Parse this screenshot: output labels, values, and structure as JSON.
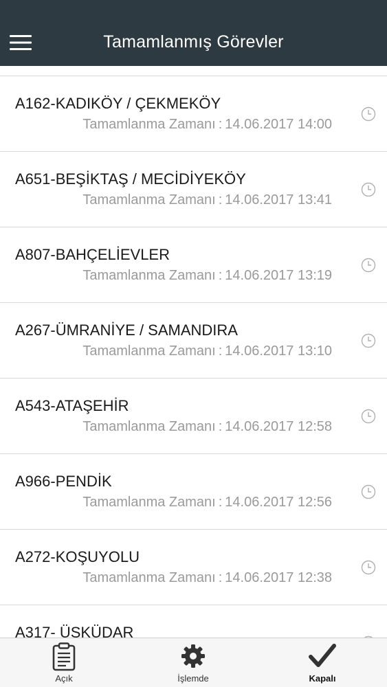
{
  "header": {
    "title": "Tamamlanmış Görevler",
    "menu_icon": "hamburger-menu-icon"
  },
  "tasks": [
    {
      "title": "A162-KADIKÖY / ÇEKMEKÖY",
      "label": "Tamamlanma Zamanı",
      "time": "14.06.2017 14:00"
    },
    {
      "title": "A651-BEŞİKTAŞ / MECİDİYEKÖY",
      "label": "Tamamlanma Zamanı",
      "time": "14.06.2017 13:41"
    },
    {
      "title": "A807-BAHÇELİEVLER",
      "label": "Tamamlanma Zamanı",
      "time": "14.06.2017 13:19"
    },
    {
      "title": "A267-ÜMRANİYE / SAMANDIRA",
      "label": "Tamamlanma Zamanı",
      "time": "14.06.2017 13:10"
    },
    {
      "title": "A543-ATAŞEHİR",
      "label": "Tamamlanma Zamanı",
      "time": "14.06.2017 12:58"
    },
    {
      "title": "A966-PENDİK",
      "label": "Tamamlanma Zamanı",
      "time": "14.06.2017 12:56"
    },
    {
      "title": "A272-KOŞUYOLU",
      "label": "Tamamlanma Zamanı",
      "time": "14.06.2017 12:38"
    },
    {
      "title": "A317- ÜSKÜDAR",
      "label": "",
      "time": ""
    }
  ],
  "time_separator": ":",
  "row_icon": "clock-icon",
  "tabbar": {
    "tabs": [
      {
        "label": "Açık",
        "icon": "clipboard-icon"
      },
      {
        "label": "İşlemde",
        "icon": "gear-icon"
      },
      {
        "label": "Kapalı",
        "icon": "checkmark-icon"
      }
    ],
    "active": "Kapalı"
  },
  "colors": {
    "navbar": "#2e3a41",
    "title": "#ffffff",
    "row_title": "#1a1a1a",
    "row_sub": "#9a9a9a",
    "divider": "#d8d8d8",
    "tabbar_bg": "#f6f6f6",
    "tab_icon": "#333333",
    "clock": "#b0b0b0"
  }
}
